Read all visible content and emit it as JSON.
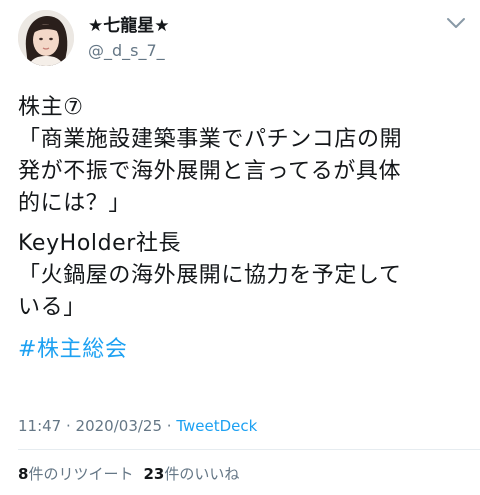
{
  "author": {
    "display_name": "★七龍星★",
    "username": "@_d_s_7_"
  },
  "tweet": {
    "lines_p1": [
      "株主⑦",
      "「商業施設建築事業でパチンコ店の開",
      "発が不振で海外展開と言ってるが具体",
      "的には？」"
    ],
    "lines_p2": [
      "KeyHolder社長",
      "「火鍋屋の海外展開に協力を予定して",
      "いる」"
    ],
    "hashtag": "#株主総会"
  },
  "meta": {
    "time": "11:47",
    "separator": " · ",
    "date": "2020/03/25",
    "separator2": " · ",
    "source": "TweetDeck"
  },
  "stats": {
    "retweet_count": "8",
    "retweet_label": "件のリツイート",
    "like_count": "23",
    "like_label": "件のいいね"
  },
  "icons": {
    "menu": "chevron-down-icon"
  }
}
